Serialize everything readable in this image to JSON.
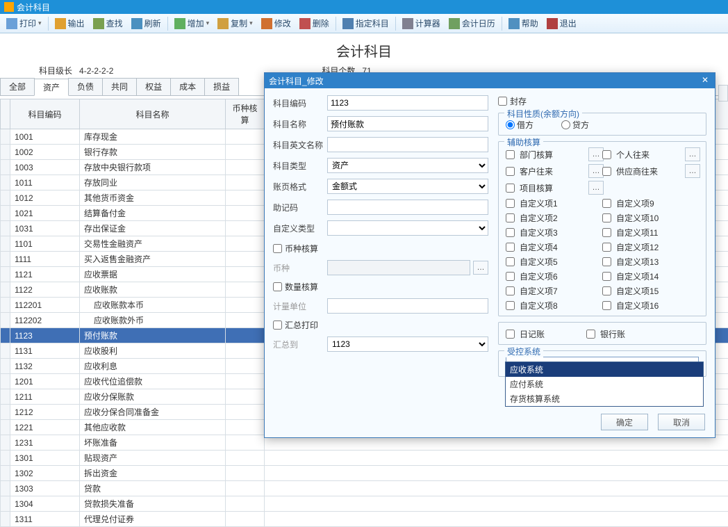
{
  "window_title": "会计科目",
  "toolbar": [
    {
      "key": "print",
      "label": "打印",
      "icon": "ic-print",
      "dd": true
    },
    {
      "key": "export",
      "label": "输出",
      "icon": "ic-export"
    },
    {
      "key": "find",
      "label": "查找",
      "icon": "ic-find"
    },
    {
      "key": "refresh",
      "label": "刷新",
      "icon": "ic-refresh"
    },
    {
      "key": "add",
      "label": "增加",
      "icon": "ic-add",
      "dd": true
    },
    {
      "key": "copy",
      "label": "复制",
      "icon": "ic-copy",
      "dd": true
    },
    {
      "key": "edit",
      "label": "修改",
      "icon": "ic-edit"
    },
    {
      "key": "delete",
      "label": "删除",
      "icon": "ic-del"
    },
    {
      "key": "assign",
      "label": "指定科目",
      "icon": "ic-assign"
    },
    {
      "key": "calc",
      "label": "计算器",
      "icon": "ic-calc"
    },
    {
      "key": "calendar",
      "label": "会计日历",
      "icon": "ic-cal"
    },
    {
      "key": "help",
      "label": "帮助",
      "icon": "ic-help"
    },
    {
      "key": "exit",
      "label": "退出",
      "icon": "ic-exit"
    }
  ],
  "page_title": "会计科目",
  "meta": {
    "level_label": "科目级长",
    "level_value": "4-2-2-2-2",
    "count_label": "科目个数",
    "count_value": "71"
  },
  "tabs": [
    "全部",
    "资产",
    "负债",
    "共同",
    "权益",
    "成本",
    "损益"
  ],
  "active_tab": 1,
  "grid": {
    "headers": {
      "code": "科目编码",
      "name": "科目名称",
      "currency": "币种核算"
    },
    "rows": [
      {
        "code": "1001",
        "name": "库存现金"
      },
      {
        "code": "1002",
        "name": "银行存款"
      },
      {
        "code": "1003",
        "name": "存放中央银行款项"
      },
      {
        "code": "1011",
        "name": "存放同业"
      },
      {
        "code": "1012",
        "name": "其他货币资金"
      },
      {
        "code": "1021",
        "name": "结算备付金"
      },
      {
        "code": "1031",
        "name": "存出保证金"
      },
      {
        "code": "1101",
        "name": "交易性金融资产"
      },
      {
        "code": "1111",
        "name": "买入返售金融资产"
      },
      {
        "code": "1121",
        "name": "应收票据"
      },
      {
        "code": "1122",
        "name": "应收账款"
      },
      {
        "code": "112201",
        "name": "应收账款本币",
        "indent": true
      },
      {
        "code": "112202",
        "name": "应收账款外币",
        "indent": true
      },
      {
        "code": "1123",
        "name": "预付账款",
        "selected": true
      },
      {
        "code": "1131",
        "name": "应收股利"
      },
      {
        "code": "1132",
        "name": "应收利息"
      },
      {
        "code": "1201",
        "name": "应收代位追偿款"
      },
      {
        "code": "1211",
        "name": "应收分保账款"
      },
      {
        "code": "1212",
        "name": "应收分保合同准备金"
      },
      {
        "code": "1221",
        "name": "其他应收款"
      },
      {
        "code": "1231",
        "name": "坏账准备"
      },
      {
        "code": "1301",
        "name": "贴现资产"
      },
      {
        "code": "1302",
        "name": "拆出资金"
      },
      {
        "code": "1303",
        "name": "贷款"
      },
      {
        "code": "1304",
        "name": "贷款损失准备"
      },
      {
        "code": "1311",
        "name": "代理兑付证券"
      }
    ]
  },
  "dialog": {
    "title": "会计科目_修改",
    "labels": {
      "code": "科目编码",
      "name": "科目名称",
      "ename": "科目英文名称",
      "type": "科目类型",
      "page_fmt": "账页格式",
      "mnemonic": "助记码",
      "custom_type": "自定义类型",
      "currency_chk": "币种核算",
      "currency": "币种",
      "qty_chk": "数量核算",
      "unit": "计量单位",
      "sum_chk": "汇总打印",
      "sum_to": "汇总到",
      "seal": "封存"
    },
    "values": {
      "code": "1123",
      "name": "预付账款",
      "type": "资产",
      "page_fmt": "金额式",
      "sum_to": "1123"
    },
    "nature": {
      "legend": "科目性质(余额方向)",
      "debit": "借方",
      "credit": "贷方",
      "selected": "debit"
    },
    "aux": {
      "legend": "辅助核算",
      "items": [
        {
          "key": "dept",
          "label": "部门核算",
          "btn": true
        },
        {
          "key": "person",
          "label": "个人往来",
          "btn": true
        },
        {
          "key": "cust",
          "label": "客户往来",
          "btn": true
        },
        {
          "key": "supplier",
          "label": "供应商往来",
          "btn": true
        },
        {
          "key": "proj",
          "label": "项目核算",
          "btn": true
        },
        {
          "key": "blank",
          "label": "",
          "btn": false
        }
      ],
      "customs_left": [
        "自定义项1",
        "自定义项2",
        "自定义项3",
        "自定义项4",
        "自定义项5",
        "自定义项6",
        "自定义项7",
        "自定义项8"
      ],
      "customs_right": [
        "自定义项9",
        "自定义项10",
        "自定义项11",
        "自定义项12",
        "自定义项13",
        "自定义项14",
        "自定义项15",
        "自定义项16"
      ]
    },
    "books": {
      "journal": "日记账",
      "bank": "银行账"
    },
    "ctrl_system": {
      "legend": "受控系统",
      "options": [
        "应收系统",
        "应付系统",
        "存货核算系统"
      ],
      "highlighted": 0
    },
    "buttons": {
      "ok": "确定",
      "cancel": "取消"
    }
  }
}
